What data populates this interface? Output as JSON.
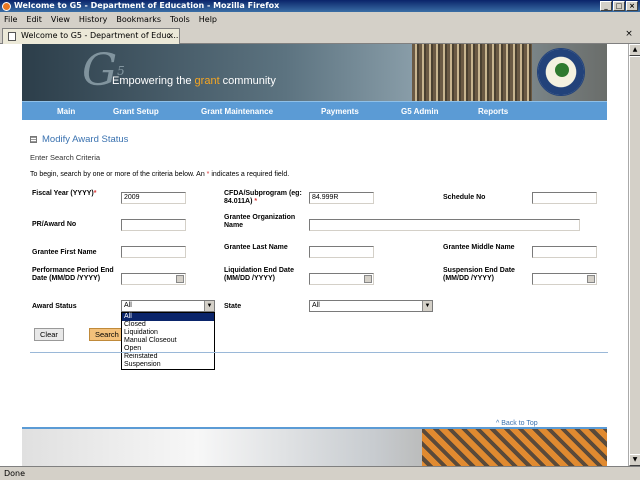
{
  "window": {
    "title": "Welcome to G5 - Department of Education - Mozilla Firefox",
    "controls": [
      "_",
      "□",
      "×"
    ]
  },
  "menu": [
    "File",
    "Edit",
    "View",
    "History",
    "Bookmarks",
    "Tools",
    "Help"
  ],
  "tab": {
    "label": "Welcome to G5 - Department of Educ...",
    "close": "×"
  },
  "status": "Done",
  "banner": {
    "logo": "G",
    "logo_sup": "5",
    "tagline_pre": "Empowering the ",
    "tagline_accent": "grant",
    "tagline_post": " community"
  },
  "nav": [
    "Main",
    "Grant Setup",
    "Grant Maintenance",
    "Payments",
    "G5 Admin",
    "Reports"
  ],
  "page": {
    "title": "Modify Award Status",
    "section": "Enter Search Criteria",
    "instruction_pre": "To begin, search by one or more of the criteria below. An ",
    "instruction_star": "*",
    "instruction_post": " indicates a required field."
  },
  "form": {
    "fiscal_year_label": "Fiscal Year (YYYY)",
    "fiscal_year_value": "2009",
    "cfda_label": "CFDA/Subprogram (eg: 84.011A)",
    "cfda_value": "84.999R",
    "schedule_label": "Schedule No",
    "pr_award_label": "PR/Award No",
    "grantee_org_label": "Grantee Organization Name",
    "grantee_first_label": "Grantee First Name",
    "grantee_last_label": "Grantee Last Name",
    "grantee_middle_label": "Grantee Middle Name",
    "perf_end_label": "Performance Period End Date (MM/DD /YYYY)",
    "liq_end_label": "Liquidation End Date (MM/DD /YYYY)",
    "susp_end_label": "Suspension End Date (MM/DD /YYYY)",
    "award_status_label": "Award Status",
    "award_status_value": "All",
    "award_status_options": [
      "All",
      "Closed",
      "Liquidation",
      "Manual Closeout",
      "Open",
      "Reinstated",
      "Suspension"
    ],
    "state_label": "State",
    "state_value": "All",
    "required_mark": "*",
    "clear_label": "Clear",
    "search_label": "Search"
  },
  "back_to_top": "^ Back to Top",
  "colors": {
    "nav": "#5b9bd5",
    "title_blue": "#3a72b0",
    "accent": "#f5a623",
    "dropdown_selected": "#0a246a"
  }
}
